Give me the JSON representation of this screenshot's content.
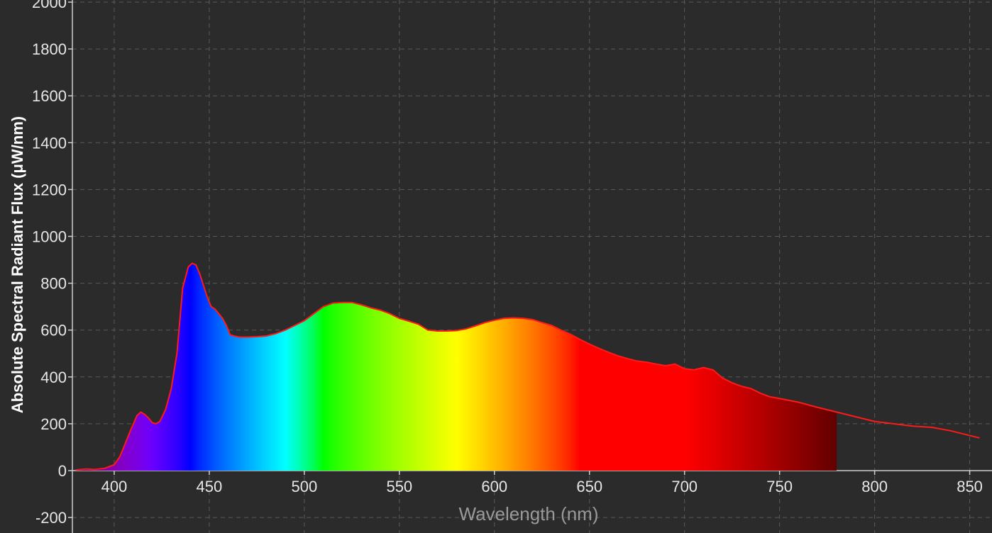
{
  "chart_data": {
    "type": "area",
    "xlabel": "Wavelength (nm)",
    "ylabel": "Absolute Spectral Radiant Flux (μW/nm)",
    "xlim": [
      378,
      858
    ],
    "ylim": [
      -200,
      2000
    ],
    "x_ticks": [
      400,
      450,
      500,
      550,
      600,
      650,
      700,
      750,
      800,
      850
    ],
    "y_ticks": [
      -200,
      0,
      200,
      400,
      600,
      800,
      1000,
      1200,
      1400,
      1600,
      1800,
      2000
    ],
    "grid": true,
    "fill": "visible spectrum gradient (380-780 nm)",
    "fill_end_nm": 780,
    "series": [
      {
        "line_color": "#ff1a1a",
        "x": [
          380,
          385,
          390,
          395,
          400,
          403,
          406,
          409,
          412,
          414,
          416,
          418,
          420,
          422,
          424,
          427,
          430,
          433,
          436,
          439,
          441,
          443,
          445,
          447,
          449,
          451,
          453,
          455,
          457,
          459,
          461,
          463,
          466,
          470,
          475,
          480,
          485,
          490,
          495,
          500,
          505,
          510,
          515,
          520,
          525,
          530,
          535,
          540,
          545,
          550,
          555,
          560,
          565,
          570,
          575,
          580,
          585,
          590,
          595,
          600,
          605,
          610,
          615,
          620,
          625,
          630,
          635,
          640,
          645,
          650,
          655,
          660,
          665,
          670,
          675,
          680,
          685,
          690,
          695,
          700,
          705,
          710,
          715,
          720,
          725,
          730,
          735,
          740,
          745,
          750,
          760,
          770,
          780,
          790,
          800,
          810,
          820,
          830,
          840,
          850,
          855
        ],
        "y": [
          3,
          7,
          5,
          10,
          25,
          60,
          120,
          180,
          235,
          250,
          240,
          225,
          205,
          200,
          210,
          260,
          350,
          500,
          780,
          870,
          885,
          878,
          840,
          790,
          740,
          700,
          690,
          670,
          650,
          620,
          580,
          575,
          570,
          570,
          572,
          575,
          585,
          600,
          620,
          640,
          670,
          700,
          715,
          718,
          718,
          708,
          695,
          685,
          670,
          650,
          638,
          625,
          600,
          596,
          596,
          598,
          605,
          618,
          632,
          642,
          650,
          652,
          650,
          645,
          632,
          620,
          600,
          582,
          560,
          540,
          522,
          505,
          490,
          478,
          468,
          463,
          455,
          448,
          455,
          435,
          430,
          440,
          430,
          395,
          375,
          360,
          350,
          330,
          315,
          308,
          292,
          270,
          250,
          230,
          210,
          200,
          190,
          185,
          170,
          150,
          140
        ]
      }
    ]
  }
}
